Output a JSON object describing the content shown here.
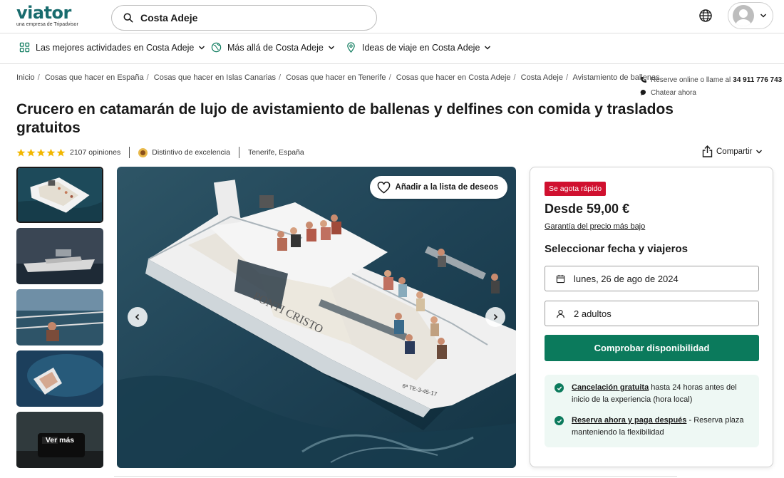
{
  "header": {
    "logo_text": "viator",
    "logo_sub": "una empresa de Tripadvisor",
    "search_value": "Costa Adeje"
  },
  "subnav": [
    {
      "label": "Las mejores actividades en Costa Adeje",
      "icon": "grid-icon"
    },
    {
      "label": "Más allá de Costa Adeje",
      "icon": "globe-icon"
    },
    {
      "label": "Ideas de viaje en Costa Adeje",
      "icon": "location-pin-icon"
    }
  ],
  "breadcrumb": [
    "Inicio",
    "Cosas que hacer en España",
    "Cosas que hacer en Islas Canarias",
    "Cosas que hacer en Tenerife",
    "Cosas que hacer en Costa Adeje",
    "Costa Adeje",
    "Avistamiento de ballenas"
  ],
  "contact": {
    "reserve_text": "Reserve online o llame al",
    "phone": "34 911 776 743",
    "chat": "Chatear ahora"
  },
  "product": {
    "title": "Crucero en catamarán de lujo de avistamiento de ballenas y delfines con comida y traslados gratuitos",
    "rating_stars": 5,
    "reviews": "2107 opiniones",
    "badge": "Distintivo de excelencia",
    "location": "Tenerife, España",
    "share": "Compartir"
  },
  "gallery": {
    "wishlist": "Añadir a la lista de deseos",
    "see_more": "Ver más",
    "boat_name": "PONTI CRISTO",
    "boat_reg": "6ª TE-3-45-17"
  },
  "booking": {
    "badge": "Se agota rápido",
    "price": "Desde 59,00 €",
    "guarantee": "Garantía del precio más bajo",
    "select_heading": "Seleccionar fecha y viajeros",
    "date": "lunes, 26 de ago de 2024",
    "travelers": "2 adultos",
    "cta": "Comprobar disponibilidad",
    "perks": [
      {
        "bold": "Cancelación gratuita",
        "text": " hasta 24 horas antes del inicio de la experiencia (hora local)"
      },
      {
        "bold": "Reserva ahora y paga después",
        "text": " - Reserva plaza manteniendo la flexibilidad"
      }
    ]
  },
  "colors": {
    "brand": "#186b6d",
    "cta": "#0b7a5c",
    "alert": "#d0102f",
    "perk_bg": "#eef8f4",
    "star": "#f2b700"
  }
}
